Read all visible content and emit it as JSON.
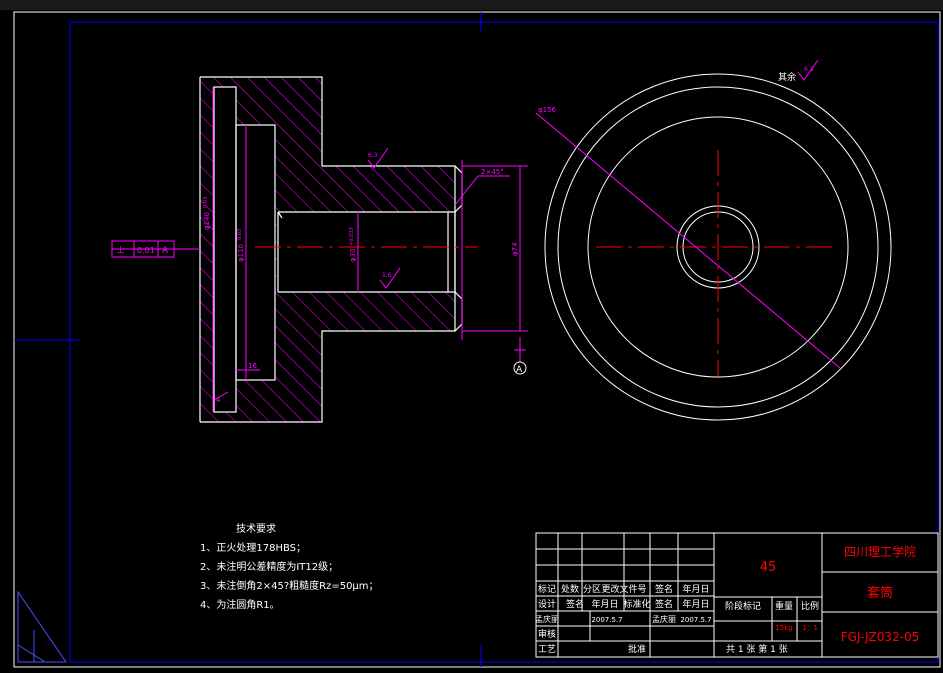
{
  "drawing": {
    "colors": {
      "outline": "#ffffff",
      "hatch": "#ff00ff",
      "dimension": "#ff00ff",
      "center": "#ff0000",
      "frame": "#0000ff",
      "title_text": "#ff0000"
    },
    "section_view": {
      "dims": {
        "d_left": "φ140",
        "d_left_tol": "0.03",
        "d_inner": "φ110",
        "d_inner_tol": "0.03",
        "d_bore": "φ30",
        "d_bore_tol": "+0.033",
        "d_shaft": "φ74",
        "chamfer": "2×45°",
        "dim_16": "16",
        "dim_4": "4"
      },
      "roughness": {
        "top": "6.3",
        "bore": "1.6"
      },
      "tolerance_frame": {
        "symbol": "⊥",
        "value": "0.01",
        "datum": "A"
      },
      "datum_label": "A"
    },
    "end_view": {
      "dim_outer": "φ156",
      "rest_label": "其余",
      "rest_roughness": "6.3"
    },
    "tech_requirements": {
      "title": "技术要求",
      "items": [
        "1、正火处理178HBS；",
        "2、未注明公差精度为IT12级；",
        "3、未注倒角2×45?粗糙度Rz=50μm；",
        "4、为注圆角R1。"
      ]
    },
    "title_block": {
      "material": "45",
      "school": "四川理工学院",
      "part_name": "套筒",
      "drawing_no": "FGJ-JZ032-05",
      "headers_row1": [
        "标记",
        "处数",
        "分区",
        "更改文件号",
        "签名",
        "年月日"
      ],
      "row_design": [
        "设计",
        "签名",
        "年月日",
        "标准化",
        "签名",
        "年月日"
      ],
      "stage_label": "阶段标记",
      "weight_label": "重量",
      "scale_label": "比例",
      "weight": "15kg",
      "scale": "1：1",
      "left_labels": [
        "孟庆丽",
        "审核",
        "工艺"
      ],
      "date1": "2007.5.7",
      "name2": "孟庆丽",
      "date2": "2007.5.7",
      "approve": "批准",
      "sheet_info": "共 1 张   第 1 张"
    }
  }
}
